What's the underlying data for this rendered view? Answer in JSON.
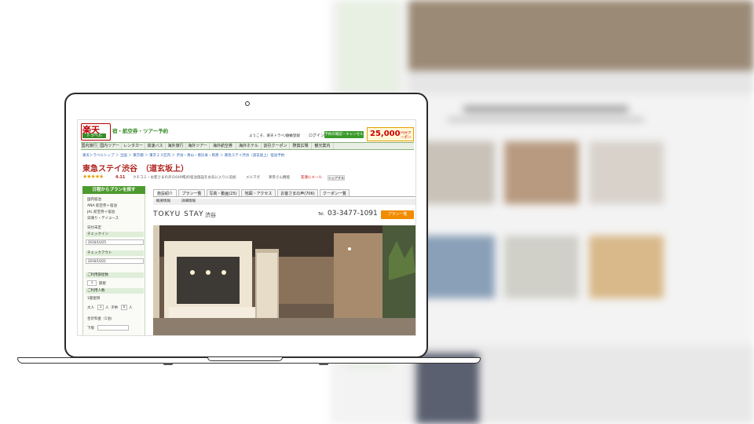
{
  "header": {
    "logo": "楽天",
    "logo_sub": "トラベル",
    "tagline": "宿・航空券・ツアー予約",
    "welcome": "ようこそ、楽天トラベルへ",
    "member": "会員登録",
    "login": "ログイン",
    "reservation_btn": "予約の確認・キャンセル",
    "coupon_amount": "25,000",
    "coupon_label": "円分クーポン"
  },
  "nav": [
    "国内旅行",
    "国内ツアー",
    "レンタカー",
    "高速バス",
    "海外旅行",
    "海外ツアー",
    "海外航空券",
    "海外ホテル",
    "割引クーポン",
    "際賞広場",
    "観光案内"
  ],
  "breadcrumb": "楽天トラベルトップ ＞ 全国 ＞ 東京都 ＞ 東京２３区内 ＞ 渋谷・青山・恵比寿・目黒 ＞ 東急ステイ渋谷（道玄坂上）宿泊予約",
  "hotel": {
    "name": "東急ステイ渋谷　（道玄坂上）",
    "stars": "★★★★★",
    "score": "4.11",
    "review_links": [
      "クチコミ・お客さまの声(1649件)",
      "この宿泊施設をお気に入りに追加",
      "メルマガ",
      "楽券さん機能",
      "友達にメール"
    ],
    "share": "シェアする"
  },
  "sidebar": {
    "title": "日程からプランを探す",
    "radios": [
      "国内宿泊",
      "ANA 航空券＋宿泊",
      "JAL 航空券＋宿泊",
      "日帰り・デイユース"
    ],
    "undecided": "日付未定",
    "checkin_label": "チェックイン",
    "checkin_value": "2016/10/25",
    "checkout_label": "チェックアウト",
    "checkout_value": "2016/10/21",
    "rooms_label": "ご利用部屋数",
    "rooms_value": "1",
    "rooms_unit": "部屋",
    "guests_label": "ご利用人数",
    "guests_per_room": "1部屋目",
    "adults": "大人",
    "adults_value": "1",
    "adults_unit": "人",
    "children": "子供",
    "children_value": "0",
    "children_unit": "人",
    "price_label": "合計料金（1泊）",
    "price_min": "下限"
  },
  "tabs": [
    "施設紹介",
    "プラン一覧",
    "写真・動画(25)",
    "地図・アクセス",
    "お客さまの声(706)",
    "クーポン一覧"
  ],
  "subtabs": [
    "概要情報",
    "詳細情報"
  ],
  "brand": {
    "logo": "TOKYU STAY",
    "suffix": "渋谷",
    "tel_label": "Tel.",
    "tel": "03-3477-1091",
    "plan_button": "プラン一覧"
  },
  "colors": {
    "brand_red": "#bb0000",
    "brand_green": "#3a9a2a",
    "orange": "#f18b00"
  }
}
